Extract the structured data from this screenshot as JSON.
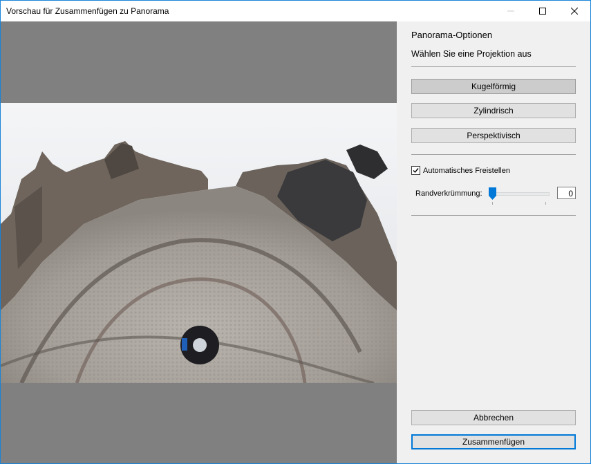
{
  "window": {
    "title": "Vorschau für Zusammenfügen zu Panorama"
  },
  "panel": {
    "heading": "Panorama-Optionen",
    "subheading": "Wählen Sie eine Projektion aus",
    "projections": [
      {
        "label": "Kugelförmig",
        "selected": true
      },
      {
        "label": "Zylindrisch",
        "selected": false
      },
      {
        "label": "Perspektivisch",
        "selected": false
      }
    ],
    "auto_crop": {
      "label": "Automatisches Freistellen",
      "checked": true
    },
    "boundary_warp": {
      "label": "Randverkrümmung:",
      "value": "0",
      "slider_fraction": 0.0
    },
    "cancel_label": "Abbrechen",
    "merge_label": "Zusammenfügen"
  },
  "colors": {
    "accent": "#0078d7",
    "preview_background": "#808080",
    "panel_background": "#f0f0f0"
  }
}
